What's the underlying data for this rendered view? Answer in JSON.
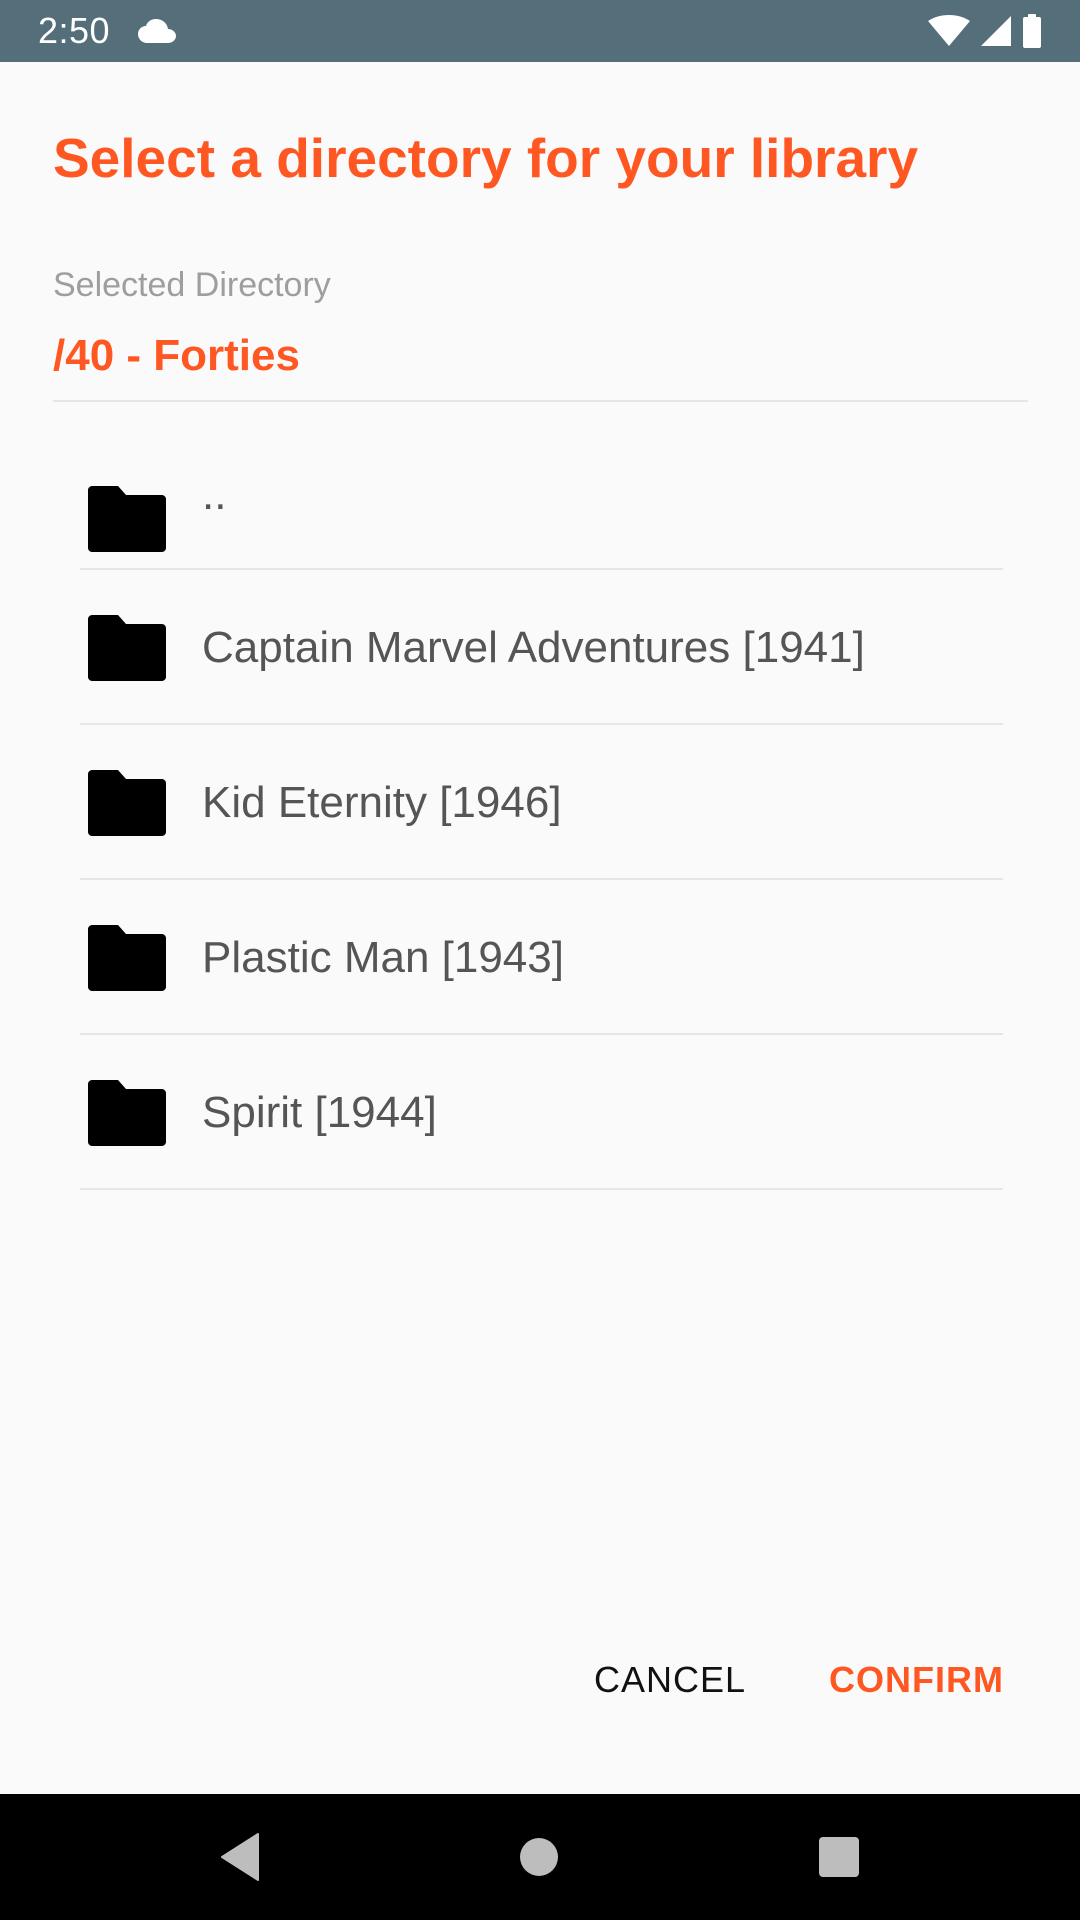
{
  "status_bar": {
    "time": "2:50",
    "left_icons": [
      "cloud-icon"
    ],
    "right_icons": [
      "wifi-icon",
      "cell-signal-icon",
      "battery-icon"
    ],
    "background": "#546e7a"
  },
  "dialog": {
    "title": "Select a directory for your library",
    "selected_label": "Selected Directory",
    "selected_path": "/40 - Forties",
    "accent_color": "#ff5722",
    "directories": [
      {
        "label": "..",
        "icon": "folder-icon"
      },
      {
        "label": "Captain Marvel Adventures [1941]",
        "icon": "folder-icon"
      },
      {
        "label": "Kid Eternity [1946]",
        "icon": "folder-icon"
      },
      {
        "label": "Plastic Man [1943]",
        "icon": "folder-icon"
      },
      {
        "label": "Spirit [1944]",
        "icon": "folder-icon"
      }
    ],
    "buttons": {
      "cancel": "CANCEL",
      "confirm": "CONFIRM"
    }
  },
  "nav_bar": {
    "icons": [
      "back-icon",
      "home-icon",
      "recents-icon"
    ]
  }
}
